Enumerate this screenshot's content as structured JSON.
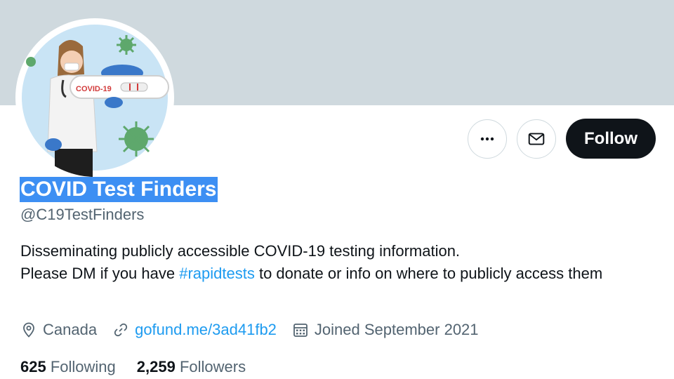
{
  "profile": {
    "name": "COVID Test Finders",
    "handle": "@C19TestFinders",
    "bio_line1": "Disseminating publicly accessible COVID-19 testing information.",
    "bio_line2_pre": "Please DM if you have ",
    "bio_hashtag": "#rapidtests",
    "bio_line2_post": " to donate or info on where to publicly access them",
    "location": "Canada",
    "link": "gofund.me/3ad41fb2",
    "joined": "Joined September 2021",
    "avatar_badge_text": "COVID-19"
  },
  "actions": {
    "more_icon": "more-dots-icon",
    "message_icon": "envelope-icon",
    "follow_label": "Follow"
  },
  "stats": {
    "following_count": "625",
    "following_label": "Following",
    "followers_count": "2,259",
    "followers_label": "Followers"
  },
  "colors": {
    "banner": "#cfd9de",
    "accent": "#1d9bf0",
    "follow_bg": "#0f1419",
    "selection": "#3d8ff3"
  }
}
